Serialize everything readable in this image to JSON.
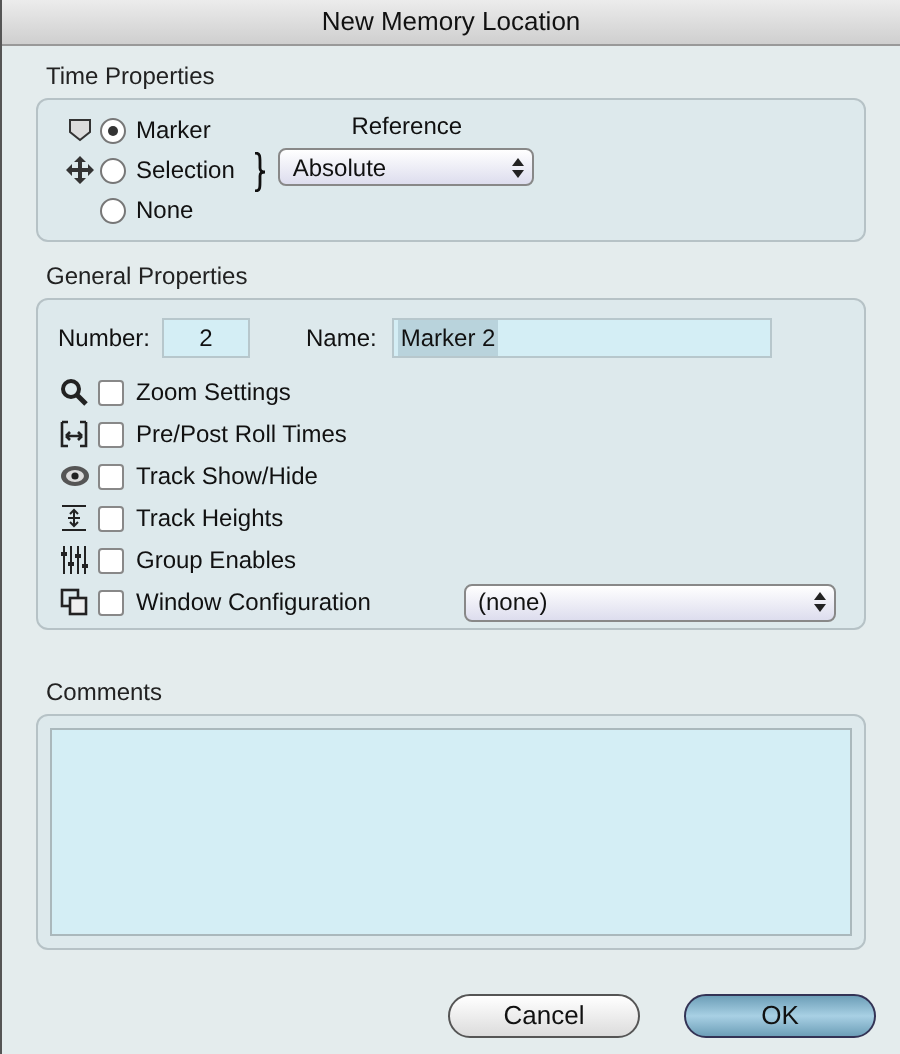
{
  "window": {
    "title": "New Memory Location"
  },
  "time_properties": {
    "label": "Time Properties",
    "options": [
      {
        "label": "Marker",
        "selected": true,
        "kind": "marker"
      },
      {
        "label": "Selection",
        "selected": false,
        "kind": "selection"
      },
      {
        "label": "None",
        "selected": false,
        "kind": "none"
      }
    ],
    "reference": {
      "label": "Reference",
      "value": "Absolute"
    }
  },
  "general_properties": {
    "label": "General Properties",
    "number": {
      "label": "Number:",
      "value": "2"
    },
    "name": {
      "label": "Name:",
      "value": "Marker 2"
    },
    "options": [
      {
        "label": "Zoom Settings",
        "checked": false,
        "kind": "zoom"
      },
      {
        "label": "Pre/Post Roll Times",
        "checked": false,
        "kind": "preroll"
      },
      {
        "label": "Track Show/Hide",
        "checked": false,
        "kind": "eye"
      },
      {
        "label": "Track Heights",
        "checked": false,
        "kind": "heights"
      },
      {
        "label": "Group Enables",
        "checked": false,
        "kind": "group"
      },
      {
        "label": "Window Configuration",
        "checked": false,
        "kind": "window",
        "select": "(none)"
      }
    ]
  },
  "comments": {
    "label": "Comments"
  },
  "buttons": [
    {
      "label": "Cancel",
      "kind": "cancel"
    },
    {
      "label": "OK",
      "kind": "default"
    }
  ]
}
